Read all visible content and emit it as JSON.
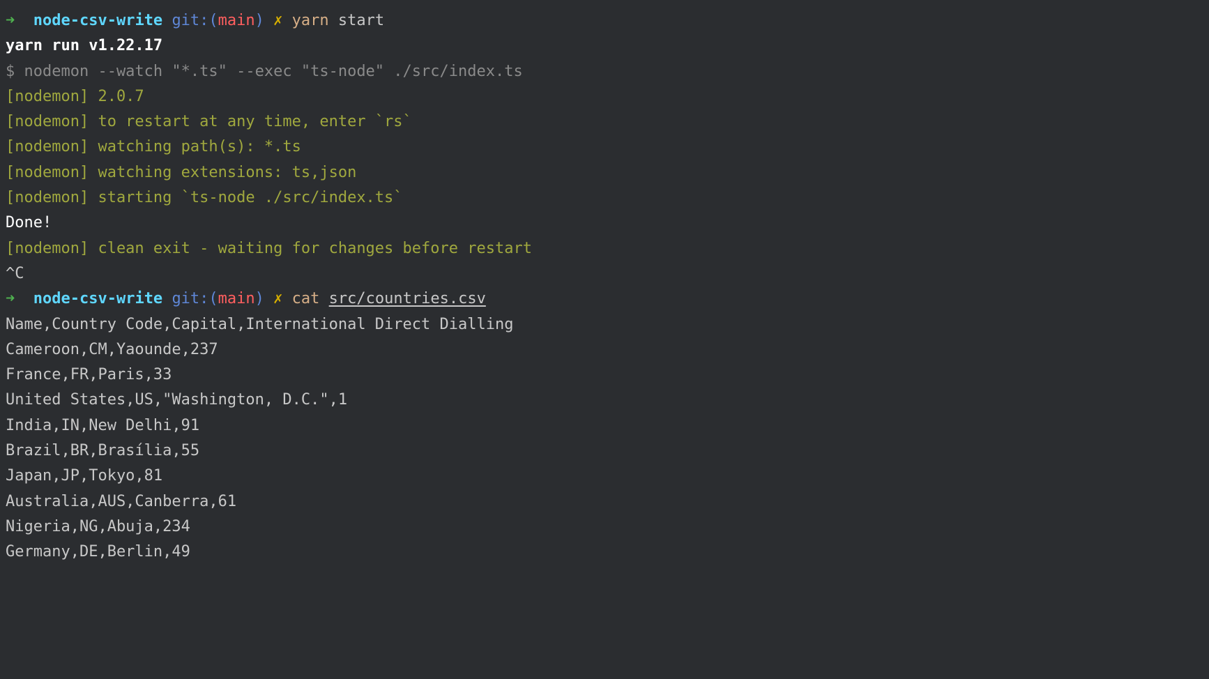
{
  "prompt1": {
    "arrow": "➜",
    "dir": "node-csv-write",
    "gitLabel": "git:(",
    "branch": "main",
    "gitClose": ")",
    "dirty": "✗",
    "cmd": "yarn",
    "arg": "start"
  },
  "yarnRun": "yarn run v1.22.17",
  "dollarLine": "$ nodemon --watch \"*.ts\" --exec \"ts-node\" ./src/index.ts",
  "nodemon": {
    "l1": "[nodemon] 2.0.7",
    "l2": "[nodemon] to restart at any time, enter `rs`",
    "l3": "[nodemon] watching path(s): *.ts",
    "l4": "[nodemon] watching extensions: ts,json",
    "l5": "[nodemon] starting `ts-node ./src/index.ts`",
    "l6": "[nodemon] clean exit - waiting for changes before restart"
  },
  "done": "Done!",
  "ctrlc": "^C",
  "prompt2": {
    "arrow": "➜",
    "dir": "node-csv-write",
    "gitLabel": "git:(",
    "branch": "main",
    "gitClose": ")",
    "dirty": "✗",
    "cmd": "cat",
    "arg": "src/countries.csv"
  },
  "csv": {
    "header": "Name,Country Code,Capital,International Direct Dialling",
    "rows": [
      "Cameroon,CM,Yaounde,237",
      "France,FR,Paris,33",
      "United States,US,\"Washington, D.C.\",1",
      "India,IN,New Delhi,91",
      "Brazil,BR,Brasília,55",
      "Japan,JP,Tokyo,81",
      "Australia,AUS,Canberra,61",
      "Nigeria,NG,Abuja,234",
      "Germany,DE,Berlin,49"
    ]
  }
}
